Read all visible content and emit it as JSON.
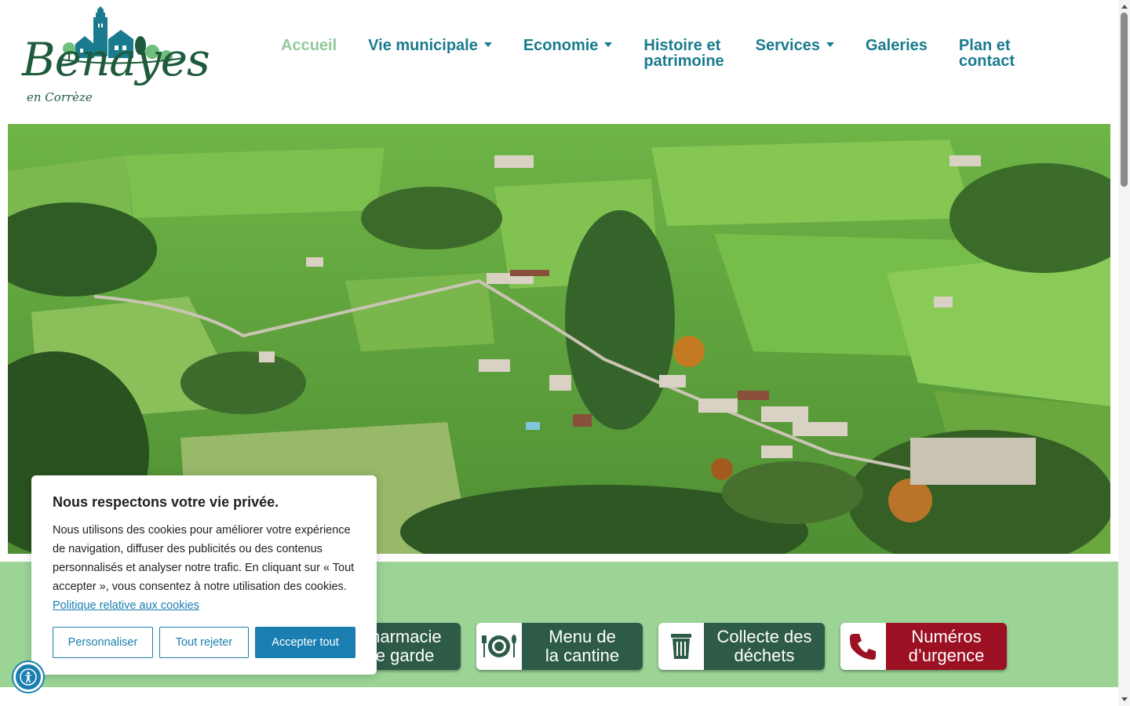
{
  "logo": {
    "name": "Benayes",
    "subtitle": "en Corrèze"
  },
  "nav": [
    {
      "label": "Accueil",
      "active": true,
      "dropdown": false
    },
    {
      "label": "Vie municipale",
      "active": false,
      "dropdown": true
    },
    {
      "label": "Economie",
      "active": false,
      "dropdown": true
    },
    {
      "label": "Histoire et\npatrimoine",
      "active": false,
      "dropdown": false
    },
    {
      "label": "Services",
      "active": false,
      "dropdown": true
    },
    {
      "label": "Galeries",
      "active": false,
      "dropdown": false
    },
    {
      "label": "Plan et\ncontact",
      "active": false,
      "dropdown": false
    }
  ],
  "tiles": [
    {
      "label": "Pharmacie\nde garde",
      "icon": "pharmacy-icon"
    },
    {
      "label": "Menu de\nla cantine",
      "icon": "plate-cutlery-icon"
    },
    {
      "label": "Collecte des\ndéchets",
      "icon": "trash-bin-icon"
    },
    {
      "label": "Numéros\nd’urgence",
      "icon": "phone-icon"
    }
  ],
  "cookie": {
    "title": "Nous respectons votre vie privée.",
    "text": "Nous utilisons des cookies pour améliorer votre expérience de navigation, diffuser des publicités ou des contenus personnalisés et analyser notre trafic. En cliquant sur « Tout accepter », vous consentez à notre utilisation des cookies.",
    "link": "Politique relative aux cookies",
    "customize": "Personnaliser",
    "reject": "Tout rejeter",
    "accept": "Accepter tout"
  },
  "colors": {
    "nav_text": "#1a7b8e",
    "nav_active": "#93c99a",
    "band": "#9bd495",
    "tile_dark": "#2d5b47",
    "tile_red": "#9b1022",
    "button_blue": "#1a7fb0",
    "logo_green": "#1e5a3c"
  },
  "hero": {
    "alt": "aerial-village-photo"
  }
}
